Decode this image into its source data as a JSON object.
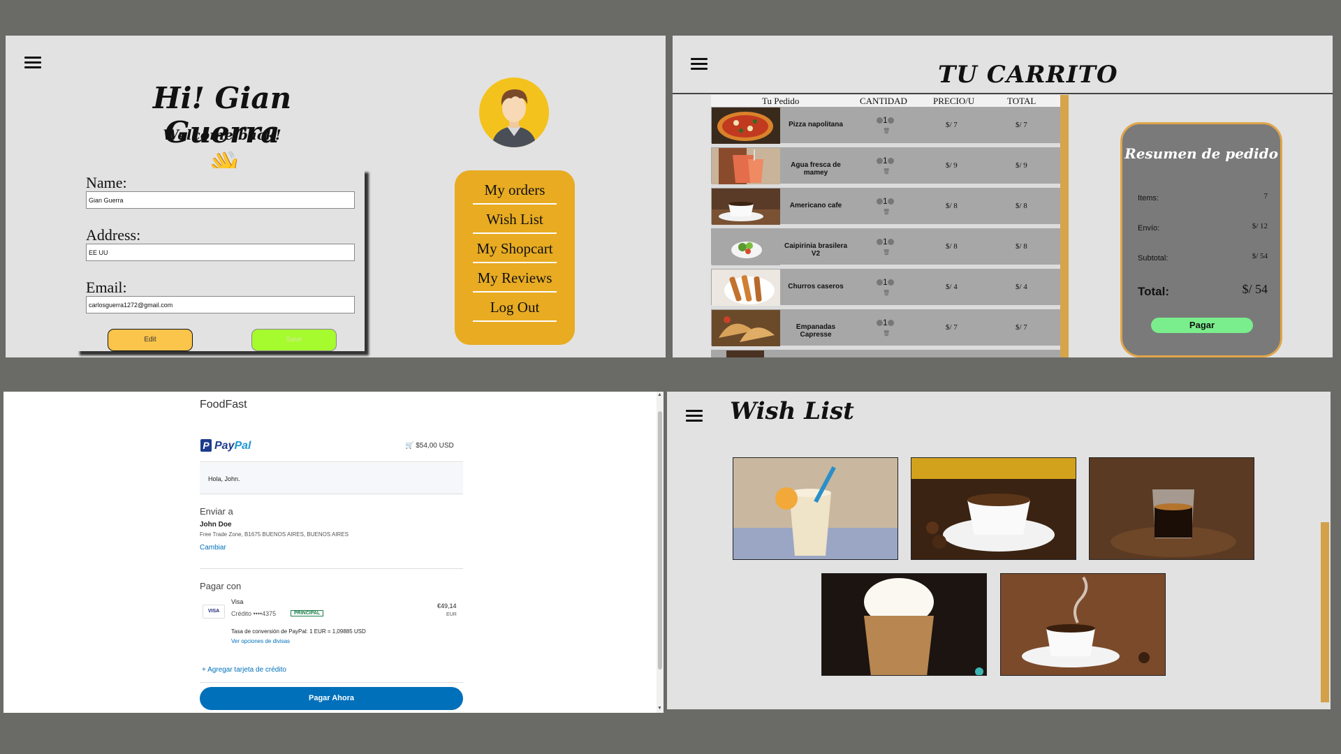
{
  "profile": {
    "greeting": "Hi! Gian Guerra",
    "welcome": "Welcome back!",
    "fields": [
      {
        "label": "Name:",
        "value": "Gian Guerra"
      },
      {
        "label": "Address:",
        "value": "EE UU"
      },
      {
        "label": "Email:",
        "value": "carlosguerra1272@gmail.com"
      }
    ],
    "edit_label": "Edit",
    "save_label": "Save",
    "menu": [
      "My orders",
      "Wish List",
      "My Shopcart",
      "My Reviews",
      "Log Out"
    ]
  },
  "cart": {
    "title": "TU CARRITO",
    "headers": [
      "Tu Pedido",
      "CANTIDAD",
      "PRECIO/U",
      "TOTAL"
    ],
    "items": [
      {
        "name": "Pizza napolitana",
        "qty": "1",
        "price": "$/ 7",
        "total": "$/ 7"
      },
      {
        "name": "Agua fresca de mamey",
        "qty": "1",
        "price": "$/ 9",
        "total": "$/ 9"
      },
      {
        "name": "Americano cafe",
        "qty": "1",
        "price": "$/ 8",
        "total": "$/ 8"
      },
      {
        "name": "Caipirinia brasilera V2",
        "qty": "1",
        "price": "$/ 8",
        "total": "$/ 8"
      },
      {
        "name": "Churros caseros",
        "qty": "1",
        "price": "$/ 4",
        "total": "$/ 4"
      },
      {
        "name": "Empanadas Capresse",
        "qty": "1",
        "price": "$/ 7",
        "total": "$/ 7"
      }
    ],
    "summary": {
      "title": "Resumen de pedido",
      "items_label": "Items:",
      "items_value": "7",
      "shipping_label": "Envío:",
      "shipping_value": "$/ 12",
      "subtotal_label": "Subtotal:",
      "subtotal_value": "$/ 54",
      "total_label": "Total:",
      "total_value": "$/ 54",
      "pay_label": "Pagar"
    }
  },
  "paypal": {
    "app_name": "FoodFast",
    "brand_pay": "Pay",
    "brand_pal": "Pal",
    "amount": "$54,00 USD",
    "hello": "Hola, John.",
    "ship_heading": "Enviar a",
    "ship_name": "John Doe",
    "ship_address": "Free Trade Zone, B1675 BUENOS AIRES, BUENOS AIRES",
    "change_link": "Cambiar",
    "pay_heading": "Pagar con",
    "card_brand": "Visa",
    "card_icon": "VISA",
    "card_desc": "Crédito ••••4375",
    "card_badge": "PRINCIPAL",
    "card_amount": "€49,14",
    "card_currency": "EUR",
    "rate_text": "Tasa de conversión de PayPal: 1 EUR = 1,09885 USD",
    "currency_link": "Ver opciones de divisas",
    "add_card": "Agregar tarjeta de crédito",
    "pay_now": "Pagar Ahora"
  },
  "wishlist": {
    "title": "Wish List",
    "items": [
      "milkshake-drink",
      "coffee-cup-beans",
      "espresso-shot",
      "whipped-cream-coffee",
      "steaming-coffee-cup"
    ]
  },
  "colors": {
    "background": "#6a6b66",
    "panel": "#e2e2e2",
    "menu_orange": "#e8ab22",
    "edit_yellow": "#fbc44a",
    "save_green": "#a6fb2f",
    "pay_green": "#7aee8c",
    "paypal_blue": "#0070ba"
  }
}
